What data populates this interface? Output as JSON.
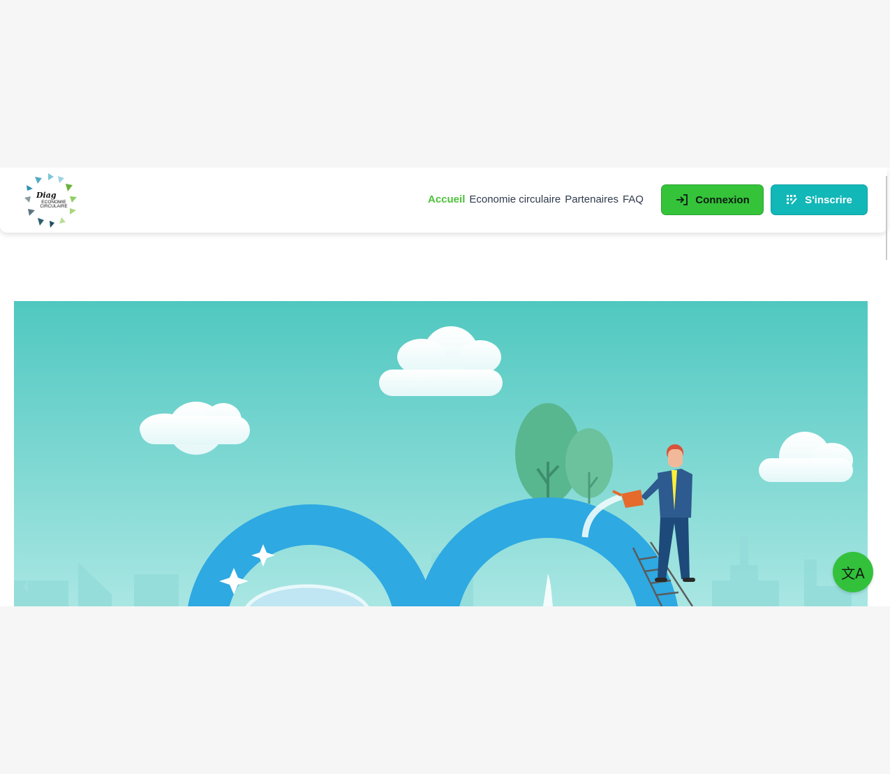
{
  "logo": {
    "title": "Diag",
    "subtitle_line1": "ECONOMIE",
    "subtitle_line2": "CIRCULAIRE"
  },
  "nav": {
    "items": [
      {
        "label": "Accueil",
        "active": true
      },
      {
        "label": "Economie circulaire",
        "active": false
      },
      {
        "label": "Partenaires",
        "active": false
      },
      {
        "label": "FAQ",
        "active": false
      }
    ]
  },
  "buttons": {
    "login_label": "Connexion",
    "login_icon": "login-arrow-icon",
    "signup_label": "S'inscrire",
    "signup_icon": "dot-grid-edit-icon"
  },
  "hero": {
    "illustration": "circular-economy-illustration",
    "prev_icon": "chevron-left-icon"
  },
  "fab": {
    "icon": "translate-icon",
    "glyph": "文A"
  },
  "colors": {
    "accent_green": "#4dc23a",
    "button_green": "#35c33a",
    "button_teal": "#12b7b8",
    "hero_sky_top": "#4fc8c0",
    "hero_sky_bottom": "#a9e6e3",
    "loop_blue": "#2ea9e2"
  }
}
